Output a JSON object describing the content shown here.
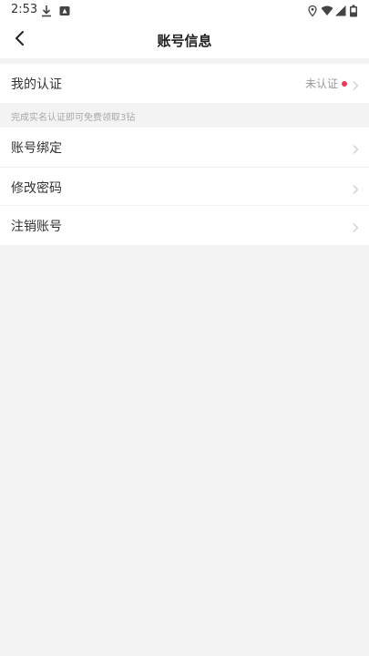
{
  "status_bar": {
    "time": "2:53",
    "left_icons": [
      "download-icon",
      "notification-icon"
    ],
    "right_icons": [
      "location-icon",
      "wifi-icon",
      "signal-icon",
      "battery-icon"
    ]
  },
  "nav": {
    "title": "账号信息",
    "back_icon": "back-arrow-icon"
  },
  "verification": {
    "label": "我的认证",
    "status": "未认证",
    "dot_color": "#f0365a"
  },
  "hint_text": "完成实名认证即可免费领取3钻",
  "menu_items": [
    {
      "label": "账号绑定"
    },
    {
      "label": "修改密码"
    },
    {
      "label": "注销账号"
    }
  ]
}
